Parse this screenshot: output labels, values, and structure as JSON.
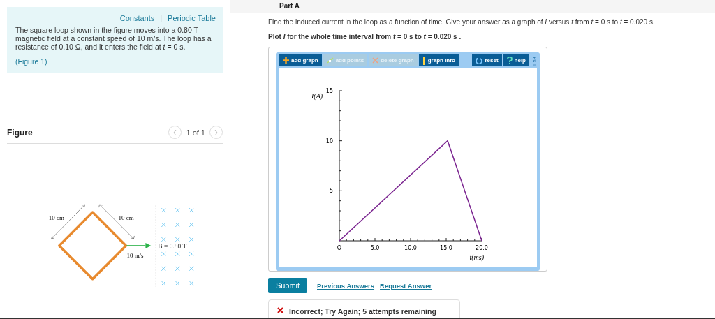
{
  "part_title": "Part A",
  "info": {
    "links": [
      "Constants",
      "Periodic Table"
    ],
    "separator": "|",
    "text": "The square loop shown in the figure moves into a 0.80 T magnetic field at a constant speed of 10 m/s. The loop has a resistance of 0.10 Ω, and it enters the field at *t* = 0 s.",
    "figure_link": "(Figure 1)"
  },
  "figure": {
    "title": "Figure",
    "pager": "1 of 1",
    "labels": {
      "side_left": "10 cm",
      "side_right": "10 cm",
      "speed": "10 m/s",
      "field": "B = 0.80 T"
    }
  },
  "question": "Find the induced current in the loop as a function of time. Give your answer as a graph of *I* versus *t* from *t* = 0 s to *t* = 0.020 s.",
  "instruction": "Plot *I* for the whole time interval from *t* = 0 s to *t* = 0.020 s .",
  "toolbar": [
    {
      "label": "add graph",
      "kind": "plus",
      "disabled": false
    },
    {
      "label": "add points",
      "kind": "points",
      "disabled": true
    },
    {
      "label": "delete graph",
      "kind": "delete",
      "disabled": true
    },
    {
      "label": "graph info",
      "kind": "info",
      "disabled": false
    },
    {
      "label": "reset",
      "kind": "reset",
      "disabled": false
    },
    {
      "label": "help",
      "kind": "help",
      "disabled": false
    }
  ],
  "version": "1.53",
  "chart_data": {
    "type": "line",
    "xlabel": "t(ms)",
    "ylabel": "I(A)",
    "x": [
      0,
      15.2,
      20
    ],
    "series": [
      {
        "color": "#7b2590",
        "values": [
          0,
          10,
          0
        ]
      }
    ],
    "xlim": [
      0,
      20
    ],
    "ylim": [
      0,
      15
    ],
    "xticks": [
      {
        "value": 0,
        "label": "O"
      },
      {
        "value": 5,
        "label": "5.0"
      },
      {
        "value": 10,
        "label": "10.0"
      },
      {
        "value": 15,
        "label": "15.0"
      },
      {
        "value": 20,
        "label": "20.0"
      }
    ],
    "yticks": [
      5,
      10,
      15
    ]
  },
  "actions": {
    "submit": "Submit",
    "links": [
      "Previous Answers",
      "Request Answer"
    ]
  },
  "feedback": {
    "text": "Incorrect; Try Again; 5 attempts remaining"
  }
}
